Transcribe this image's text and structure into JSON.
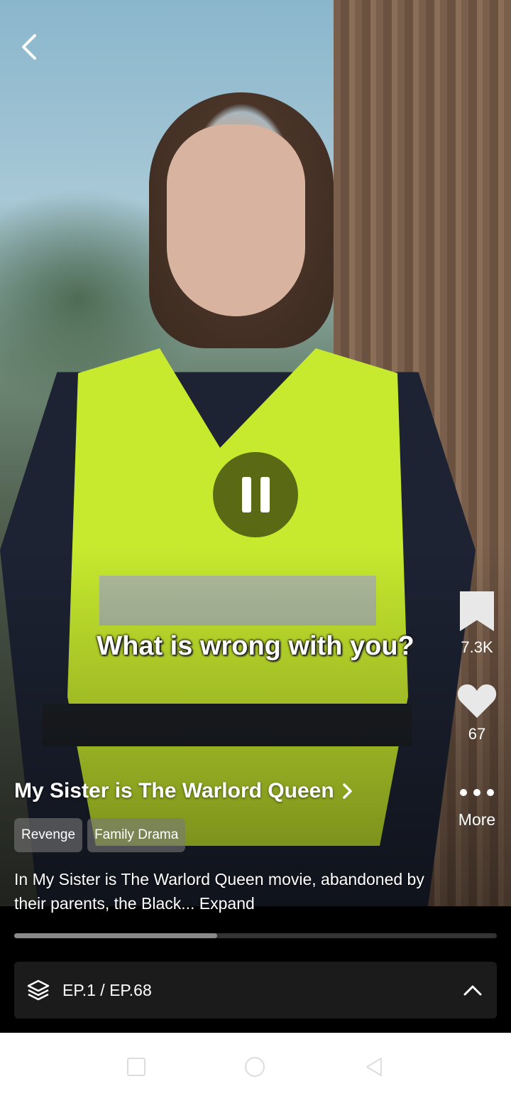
{
  "player": {
    "subtitle": "What is wrong with you?",
    "bookmark_count": "7.3K",
    "like_count": "67",
    "more_label": "More",
    "progress_fraction": 0.42
  },
  "drama": {
    "title": "My Sister is The Warlord Queen",
    "tags": [
      "Revenge",
      "Family Drama"
    ],
    "description": "In My Sister is The Warlord Queen movie, abandoned by their parents, the Black...",
    "expand_label": "Expand"
  },
  "episodes": {
    "label": "EP.1 / EP.68"
  },
  "icons": {
    "back": "back-arrow-icon",
    "pause": "pause-icon",
    "bookmark": "bookmark-icon",
    "like": "heart-icon",
    "more": "more-dots-icon",
    "episodes": "layers-icon",
    "expand_panel": "chevron-up-icon"
  },
  "colors": {
    "accent_vest": "#c8ea2e",
    "panel_bg": "#1b1b1b"
  }
}
